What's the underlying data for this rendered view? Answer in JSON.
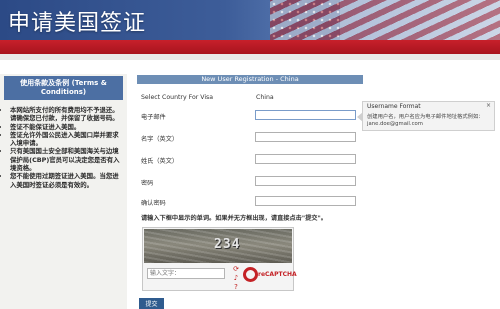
{
  "header": {
    "title": "申请美国签证"
  },
  "sidebar": {
    "heading": "使用条款及条例 (Terms & Conditions)",
    "items": [
      "本网站所支付的所有费用均不予退还。请确保您已付款，并保留了收据号码。",
      "签证不能保证进入美国。",
      "签证允许外国公民进入美国口岸并要求入境申请。",
      "只有美国国土安全部和美国海关与边境保护局(CBP)官员可以决定您是否有入境资格。",
      "您不能使用过期签证进入美国。当您进入美国时签证必须是有效的。"
    ]
  },
  "form": {
    "heading": "New User Registration - China",
    "country_label": "Select Country For Visa",
    "country_value": "China",
    "fields": [
      {
        "label": "电子邮件",
        "value": ""
      },
      {
        "label": "名字（英文）",
        "value": ""
      },
      {
        "label": "姓氏（英文）",
        "value": ""
      },
      {
        "label": "密码",
        "value": ""
      },
      {
        "label": "确认密码",
        "value": ""
      }
    ],
    "captcha_instruction": "请输入下框中显示的单词。如果并无方框出现，请直接点击\"提交\"。",
    "captcha_code": "234",
    "captcha_placeholder": "输入文字：",
    "captcha_brand": "reCAPTCHA",
    "submit_label": "提交"
  },
  "tooltip": {
    "title": "Username Format",
    "close": "×",
    "body": "创建用户名，用户名应为电子邮件地址格式例如：jane.doe@gmail.com"
  }
}
